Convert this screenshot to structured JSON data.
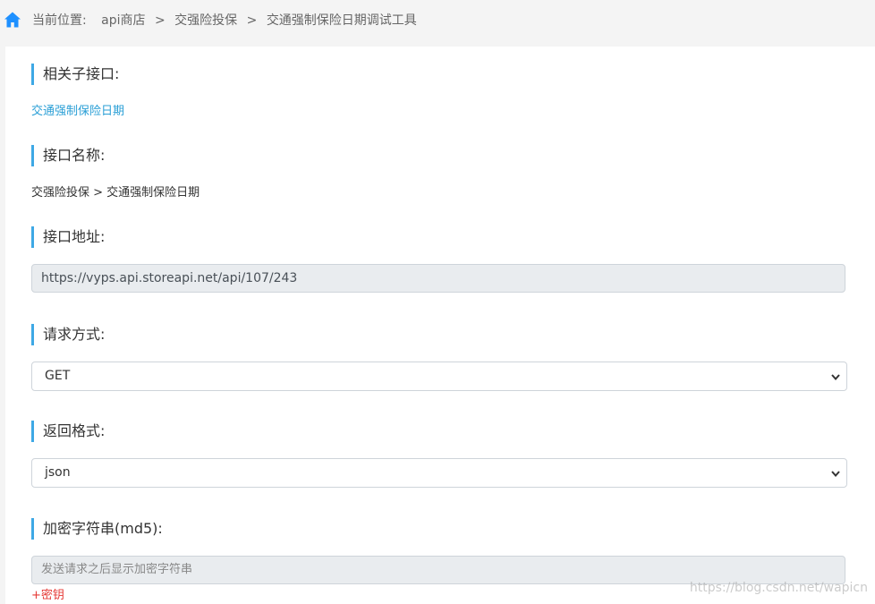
{
  "breadcrumb": {
    "prefix": "当前位置:",
    "items": [
      "api商店",
      "交强险投保",
      "交通强制保险日期调试工具"
    ],
    "separator": ">",
    "icon": "home-icon"
  },
  "sections": {
    "related": {
      "title": "相关子接口:",
      "link": "交通强制保险日期"
    },
    "name": {
      "title": "接口名称:",
      "value": "交强险投保 > 交通强制保险日期"
    },
    "address": {
      "title": "接口地址:",
      "value": "https://vyps.api.storeapi.net/api/107/243"
    },
    "method": {
      "title": "请求方式:",
      "selected": "GET"
    },
    "format": {
      "title": "返回格式:",
      "selected": "json"
    },
    "md5": {
      "title": "加密字符串(md5):",
      "placeholder": "发送请求之后显示加密字符串",
      "add_key": "+密钥"
    }
  },
  "watermark": "https://blog.csdn.net/wapicn",
  "colors": {
    "accent": "#3ea8e5",
    "link": "#2a9fd6",
    "danger": "#e53935",
    "home_icon": "#1e90ff"
  }
}
